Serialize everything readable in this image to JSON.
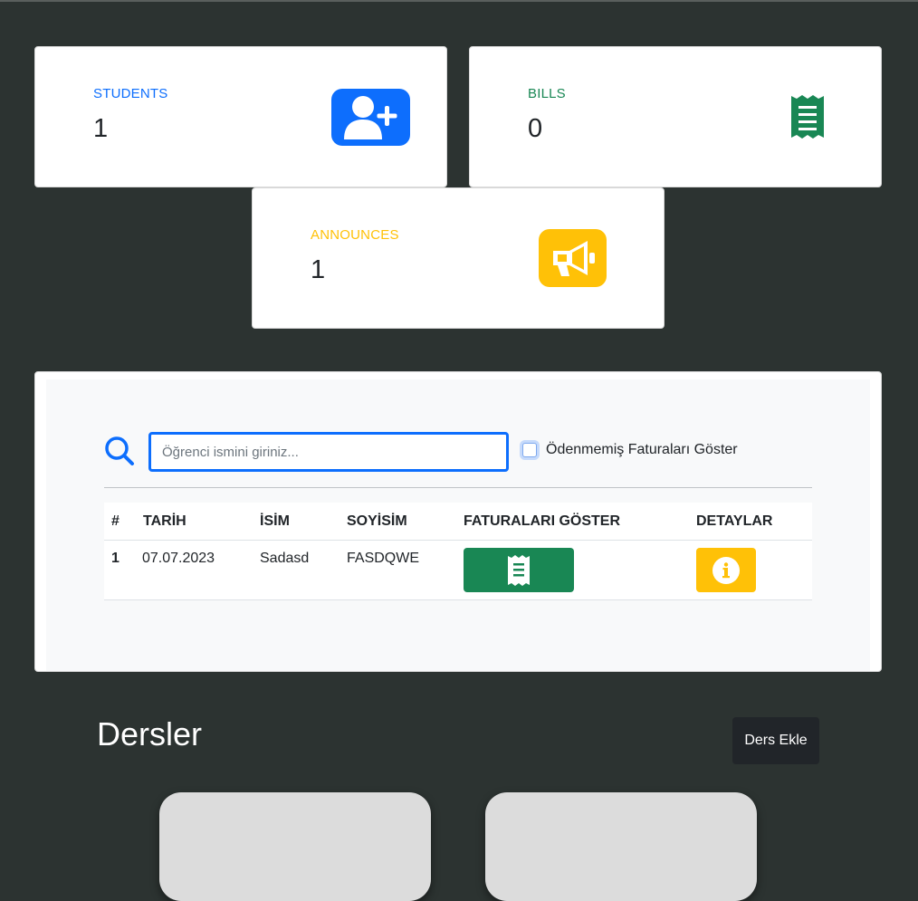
{
  "stats": {
    "students": {
      "label": "STUDENTS",
      "value": "1",
      "icon": "user-plus-icon",
      "color": "#0d6efd"
    },
    "bills": {
      "label": "BILLS",
      "value": "0",
      "icon": "receipt-icon",
      "color": "#198754"
    },
    "announces": {
      "label": "ANNOUNCES",
      "value": "1",
      "icon": "megaphone-icon",
      "color": "#ffc107"
    }
  },
  "search": {
    "placeholder": "Öğrenci ismini giriniz...",
    "value": "",
    "checkbox_label": "Ödenmemiş Faturaları Göster",
    "checked": false
  },
  "table": {
    "headers": [
      "#",
      "TARİH",
      "İSİM",
      "SOYİSİM",
      "FATURALARI GÖSTER",
      "DETAYLAR"
    ],
    "rows": [
      {
        "no": "1",
        "date": "07.07.2023",
        "name": "Sadasd",
        "surname": "FASDQWE"
      }
    ]
  },
  "courses": {
    "title": "Dersler",
    "add_button": "Ders Ekle"
  }
}
